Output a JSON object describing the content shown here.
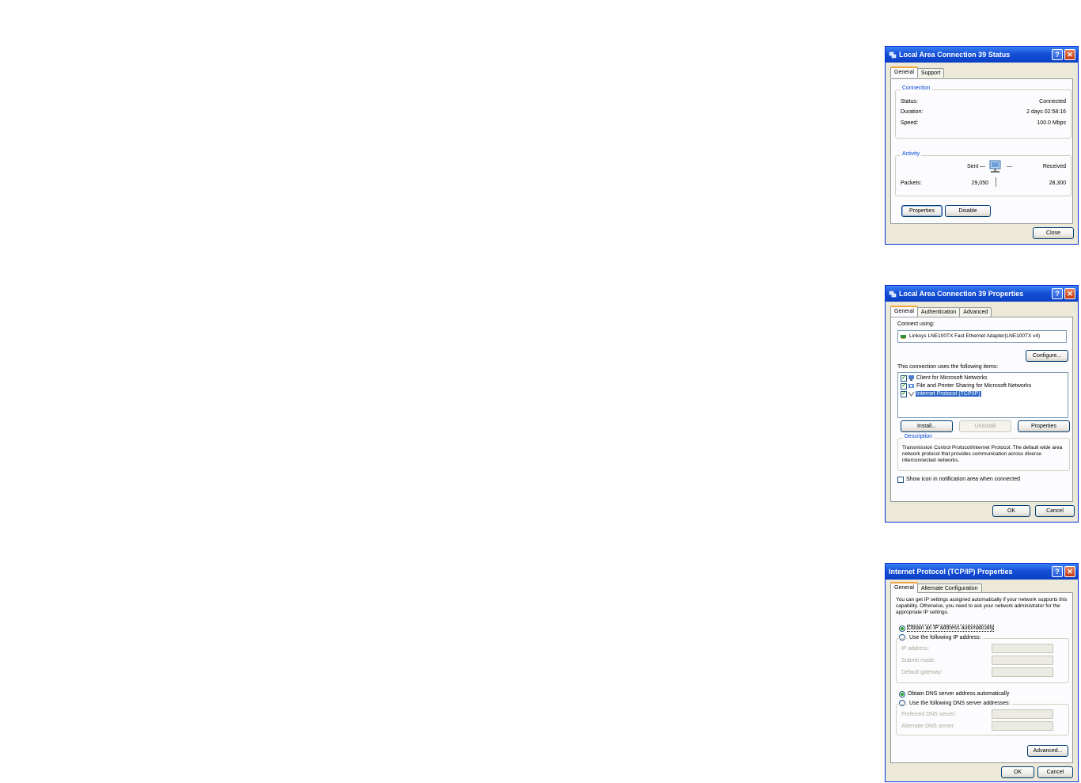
{
  "status_dialog": {
    "title": "Local Area Connection 39 Status",
    "tabs": [
      "General",
      "Support"
    ],
    "connection_group": "Connection",
    "status_label": "Status:",
    "status_value": "Connected",
    "duration_label": "Duration:",
    "duration_value": "2 days 02:58:16",
    "speed_label": "Speed:",
    "speed_value": "100.0 Mbps",
    "activity_group": "Activity",
    "sent_label": "Sent",
    "received_label": "Received",
    "packets_label": "Packets:",
    "packets_sent": "29,050",
    "packets_received": "28,300",
    "properties_button": "Properties",
    "disable_button": "Disable",
    "close_button": "Close"
  },
  "properties_dialog": {
    "title": "Local Area Connection 39 Properties",
    "tabs": [
      "General",
      "Authentication",
      "Advanced"
    ],
    "connect_using_label": "Connect using:",
    "adapter_name": "Linksys LNE100TX Fast Ethernet Adapter(LNE100TX v4)",
    "configure_button": "Configure...",
    "items_label": "This connection uses the following items:",
    "items": [
      "Client for Microsoft Networks",
      "File and Printer Sharing for Microsoft Networks",
      "Internet Protocol (TCP/IP)"
    ],
    "install_button": "Install...",
    "uninstall_button": "Uninstall",
    "properties_button": "Properties",
    "description_group": "Description",
    "description_text": "Transmission Control Protocol/Internet Protocol. The default wide area network protocol that provides communication across diverse interconnected networks.",
    "show_icon_label": "Show icon in notification area when connected",
    "ok_button": "OK",
    "cancel_button": "Cancel"
  },
  "tcpip_dialog": {
    "title": "Internet Protocol (TCP/IP) Properties",
    "tabs": [
      "General",
      "Alternate Configuration"
    ],
    "intro_text": "You can get IP settings assigned automatically if your network supports this capability. Otherwise, you need to ask your network administrator for the appropriate IP settings.",
    "obtain_ip_label": "Obtain an IP address automatically",
    "use_ip_label": "Use the following IP address:",
    "ip_address_label": "IP address:",
    "subnet_mask_label": "Subnet mask:",
    "gateway_label": "Default gateway:",
    "obtain_dns_label": "Obtain DNS server address automatically",
    "use_dns_label": "Use the following DNS server addresses:",
    "preferred_dns_label": "Preferred DNS server:",
    "alternate_dns_label": "Alternate DNS server:",
    "advanced_button": "Advanced...",
    "ok_button": "OK",
    "cancel_button": "Cancel"
  },
  "colors": {
    "title_blue": "#1550d8",
    "dialog_bg": "#ece9d8",
    "group_title": "#0046d5",
    "check_green": "#21a121"
  }
}
